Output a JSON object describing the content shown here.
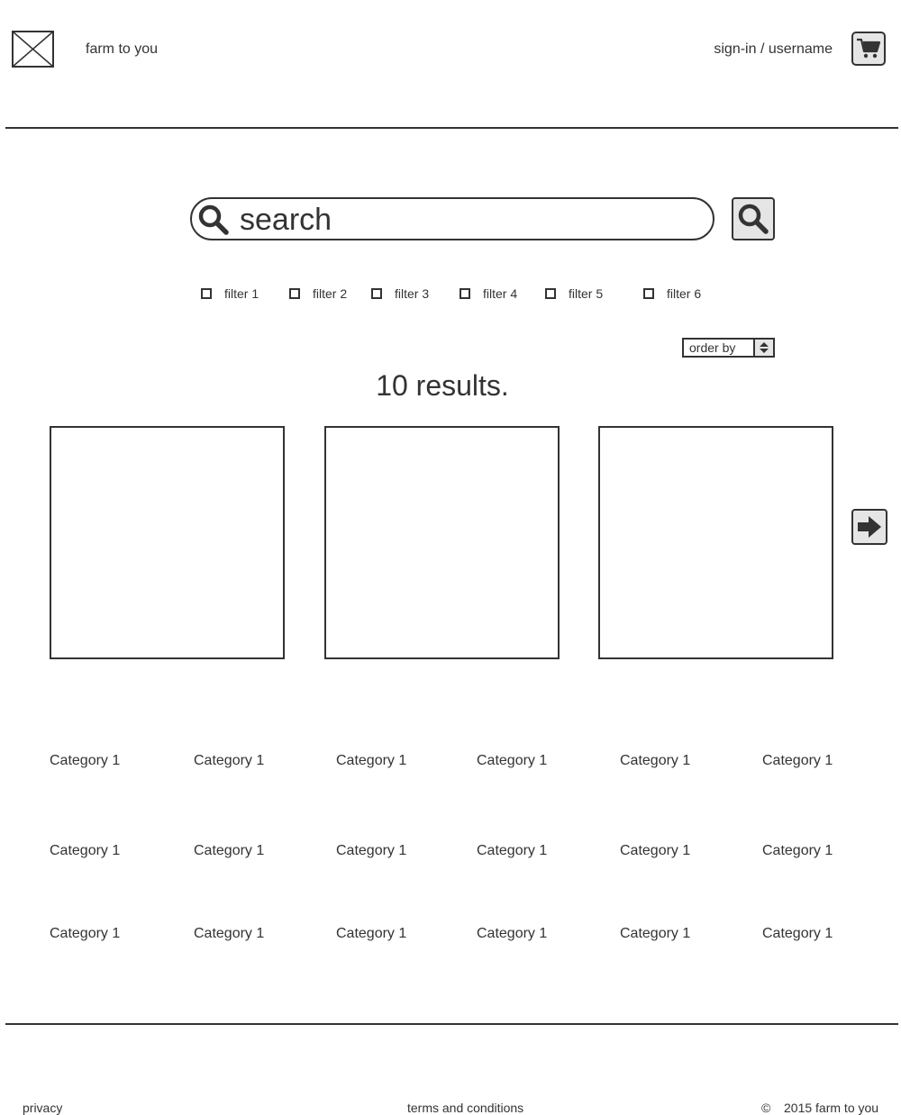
{
  "header": {
    "brand": "farm to you",
    "signin": "sign-in / username"
  },
  "search": {
    "placeholder": "search"
  },
  "filters": [
    "filter 1",
    "filter 2",
    "filter 3",
    "filter 4",
    "filter 5",
    "filter 6"
  ],
  "order_by": "order by",
  "results_text": "10 results.",
  "categories": [
    [
      "Category 1",
      "Category 1",
      "Category 1",
      "Category 1",
      "Category 1",
      "Category 1"
    ],
    [
      "Category 1",
      "Category 1",
      "Category 1",
      "Category 1",
      "Category 1",
      "Category 1"
    ],
    [
      "Category 1",
      "Category 1",
      "Category 1",
      "Category 1",
      "Category 1",
      "Category 1"
    ]
  ],
  "footer": {
    "privacy": "privacy",
    "terms": "terms and conditions",
    "copyright_symbol": "©",
    "copyright": "2015 farm to you"
  }
}
